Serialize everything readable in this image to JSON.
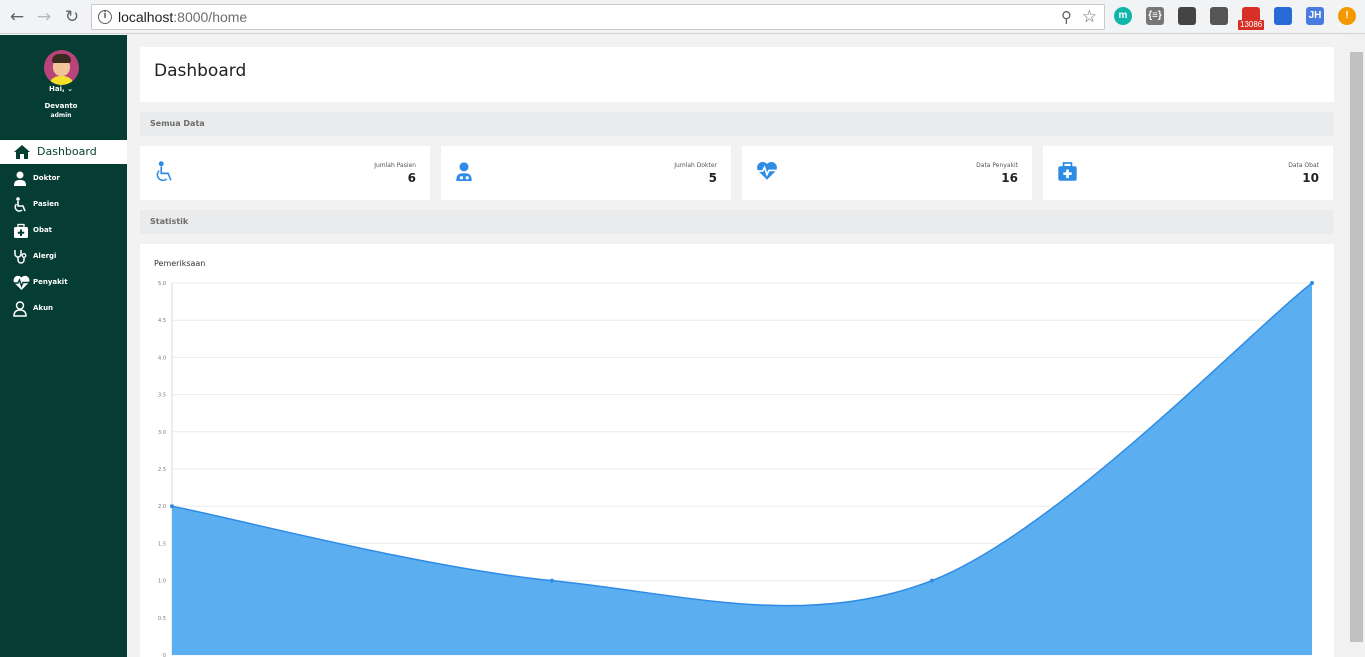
{
  "browser": {
    "url_host": "localhost",
    "url_path": ":8000/home",
    "extensions": [
      {
        "name": "m-ext",
        "label": "m",
        "color": "#0fb6a8"
      },
      {
        "name": "json-ext",
        "label": "{≡}",
        "color": "#777777"
      },
      {
        "name": "camera-ext",
        "label": "",
        "color": "#444444"
      },
      {
        "name": "chat-ext",
        "label": "",
        "color": "#555555"
      },
      {
        "name": "gmail-ext",
        "label": "",
        "color": "#d93025"
      },
      {
        "name": "window-ext",
        "label": "",
        "color": "#2a6ad8"
      },
      {
        "name": "jh-ext",
        "label": "JH",
        "color": "#4a7be0"
      },
      {
        "name": "alert-ext",
        "label": "!",
        "color": "#f29900"
      }
    ],
    "gmail_badge": "13086"
  },
  "user": {
    "greeting": "Hai,",
    "name": "Devanto",
    "role": "admin"
  },
  "sidebar": {
    "items": [
      {
        "label": "Dashboard",
        "icon": "home-icon"
      },
      {
        "label": "Doktor",
        "icon": "doctor-icon"
      },
      {
        "label": "Pasien",
        "icon": "wheelchair-icon"
      },
      {
        "label": "Obat",
        "icon": "medkit-icon"
      },
      {
        "label": "Alergi",
        "icon": "stethoscope-icon"
      },
      {
        "label": "Penyakit",
        "icon": "heartbeat-icon"
      },
      {
        "label": "Akun",
        "icon": "user-icon"
      }
    ]
  },
  "page": {
    "title": "Dashboard",
    "section_all": "Semua Data",
    "section_stats": "Statistik"
  },
  "cards": [
    {
      "label": "Jumlah Pasien",
      "value": "6",
      "icon": "wheelchair-icon"
    },
    {
      "label": "Jumlah Dokter",
      "value": "5",
      "icon": "doctor-icon"
    },
    {
      "label": "Data Penyakit",
      "value": "16",
      "icon": "heartbeat-icon"
    },
    {
      "label": "Data Obat",
      "value": "10",
      "icon": "medkit-icon"
    }
  ],
  "colors": {
    "sidebar": "#053c33",
    "accent": "#2e8be6",
    "area_fill": "#5baeef"
  },
  "chart_data": {
    "type": "area",
    "title": "Pemeriksaan",
    "y_ticks": [
      "0",
      "0.5",
      "1.0",
      "1.5",
      "2.0",
      "2.5",
      "3.0",
      "3.5",
      "4.0",
      "4.5",
      "5.0"
    ],
    "ylim": [
      0,
      5
    ],
    "x": [
      0,
      1,
      2,
      3
    ],
    "values": [
      2,
      1,
      1,
      5
    ],
    "grid": true
  }
}
